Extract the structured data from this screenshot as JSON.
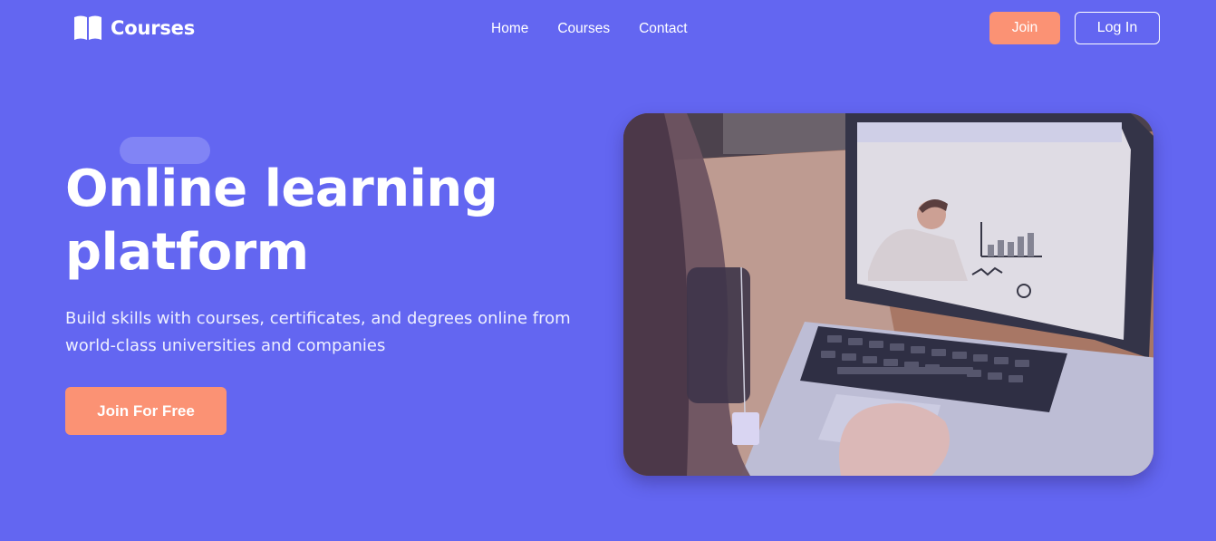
{
  "brand": {
    "name": "Courses",
    "icon": "book-open-icon"
  },
  "nav": {
    "items": [
      {
        "label": "Home"
      },
      {
        "label": "Courses"
      },
      {
        "label": "Contact"
      }
    ]
  },
  "auth": {
    "join_label": "Join",
    "login_label": "Log In"
  },
  "hero": {
    "title_line1": "Online learning",
    "title_line2": "platform",
    "subtitle_line1": "Build skills with courses, certificates, and degrees online from",
    "subtitle_line2": "world-class universities and companies",
    "cta_label": "Join For Free",
    "image": "student-laptop-online-lesson-photo"
  },
  "colors": {
    "background": "#6366f1",
    "accent": "#fb9274",
    "text": "#ffffff"
  }
}
